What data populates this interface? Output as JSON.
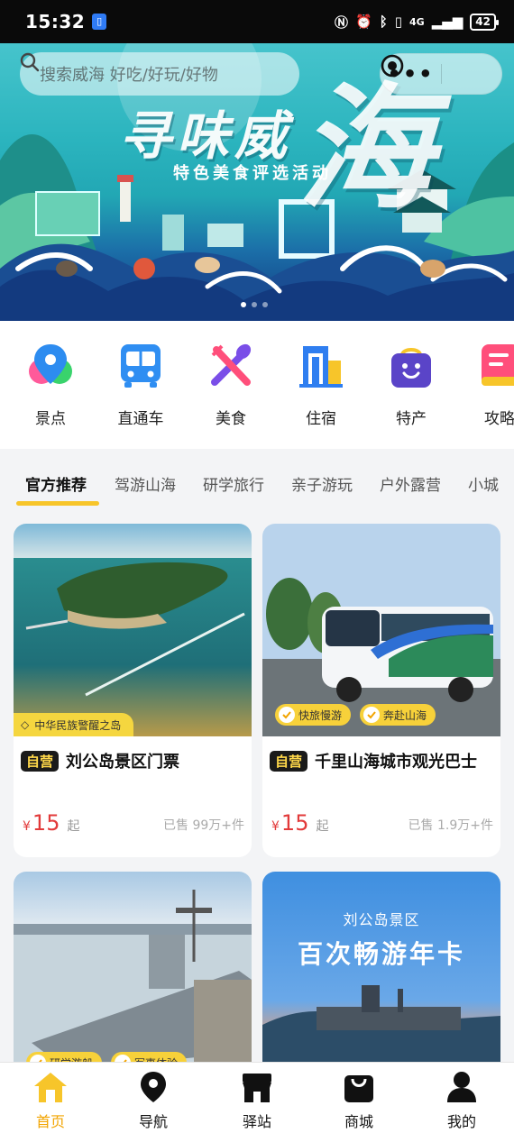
{
  "status_bar": {
    "time": "15:32",
    "network": "4G",
    "battery": "42"
  },
  "search": {
    "placeholder": "搜索威海 好吃/好玩/好物"
  },
  "banner": {
    "title": "寻味威",
    "big_char": "海",
    "subtitle": "特色美食评选活动"
  },
  "categories": [
    {
      "label": "景点",
      "icon": "map-pin-icon"
    },
    {
      "label": "直通车",
      "icon": "bus-icon"
    },
    {
      "label": "美食",
      "icon": "fork-spoon-icon"
    },
    {
      "label": "住宿",
      "icon": "hotel-icon"
    },
    {
      "label": "特产",
      "icon": "shopping-bag-icon"
    },
    {
      "label": "攻略",
      "icon": "guide-book-icon"
    }
  ],
  "tabs": [
    "官方推荐",
    "驾游山海",
    "研学旅行",
    "亲子游玩",
    "户外露营",
    "小城"
  ],
  "products": [
    {
      "badge": "自营",
      "title": "刘公岛景区门票",
      "currency": "¥",
      "price": "15",
      "suffix": "起",
      "sold": "已售 99万+件",
      "tag": "中华民族警醒之岛"
    },
    {
      "badge": "自营",
      "title": "千里山海城市观光巴士",
      "currency": "¥",
      "price": "15",
      "suffix": "起",
      "sold": "已售 1.9万+件",
      "chips": [
        "快旅慢游",
        "奔赴山海"
      ]
    },
    {
      "chips": [
        "研学游船",
        "军事体验"
      ]
    },
    {
      "overlay_sub": "刘公岛景区",
      "overlay_title": "百次畅游年卡"
    }
  ],
  "bottom_nav": [
    {
      "label": "首页",
      "icon": "home-icon",
      "active": true
    },
    {
      "label": "导航",
      "icon": "location-icon"
    },
    {
      "label": "驿站",
      "icon": "store-icon"
    },
    {
      "label": "商城",
      "icon": "shopping-bag-icon"
    },
    {
      "label": "我的",
      "icon": "user-icon"
    }
  ],
  "colors": {
    "accent": "#f7c52a",
    "price": "#e23a3a",
    "active_nav": "#f2a400"
  }
}
